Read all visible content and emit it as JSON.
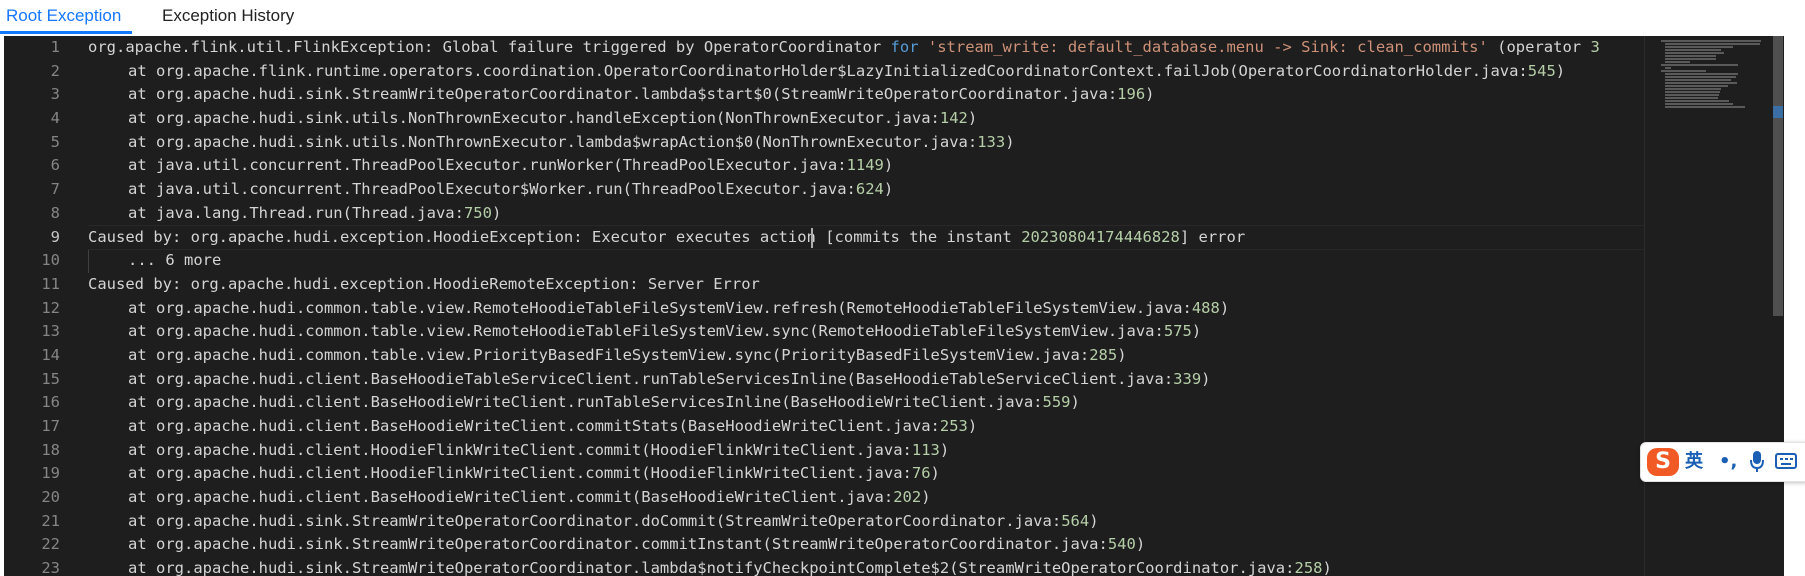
{
  "tabs": [
    {
      "label": "Root Exception",
      "active": true
    },
    {
      "label": "Exception History",
      "active": false
    }
  ],
  "editor": {
    "active_line": 9,
    "lines": [
      {
        "n": "1",
        "indent": 0,
        "segs": [
          [
            "t",
            "org.apache.flink.util.FlinkException: Global failure triggered by OperatorCoordinator "
          ],
          [
            "k",
            "for"
          ],
          [
            "t",
            " "
          ],
          [
            "s",
            "'stream_write: default_database.menu -> Sink: clean_commits'"
          ],
          [
            "t",
            " (operator "
          ],
          [
            "n",
            "3"
          ]
        ]
      },
      {
        "n": "2",
        "indent": 1,
        "segs": [
          [
            "t",
            "at org.apache.flink.runtime.operators.coordination.OperatorCoordinatorHolder$LazyInitializedCoordinatorContext.failJob(OperatorCoordinatorHolder.java:"
          ],
          [
            "n",
            "545"
          ],
          [
            "t",
            ")"
          ]
        ]
      },
      {
        "n": "3",
        "indent": 1,
        "segs": [
          [
            "t",
            "at org.apache.hudi.sink.StreamWriteOperatorCoordinator.lambda$start$0(StreamWriteOperatorCoordinator.java:"
          ],
          [
            "n",
            "196"
          ],
          [
            "t",
            ")"
          ]
        ]
      },
      {
        "n": "4",
        "indent": 1,
        "segs": [
          [
            "t",
            "at org.apache.hudi.sink.utils.NonThrownExecutor.handleException(NonThrownExecutor.java:"
          ],
          [
            "n",
            "142"
          ],
          [
            "t",
            ")"
          ]
        ]
      },
      {
        "n": "5",
        "indent": 1,
        "segs": [
          [
            "t",
            "at org.apache.hudi.sink.utils.NonThrownExecutor.lambda$wrapAction$0(NonThrownExecutor.java:"
          ],
          [
            "n",
            "133"
          ],
          [
            "t",
            ")"
          ]
        ]
      },
      {
        "n": "6",
        "indent": 1,
        "segs": [
          [
            "t",
            "at java.util.concurrent.ThreadPoolExecutor.runWorker(ThreadPoolExecutor.java:"
          ],
          [
            "n",
            "1149"
          ],
          [
            "t",
            ")"
          ]
        ]
      },
      {
        "n": "7",
        "indent": 1,
        "segs": [
          [
            "t",
            "at java.util.concurrent.ThreadPoolExecutor$Worker.run(ThreadPoolExecutor.java:"
          ],
          [
            "n",
            "624"
          ],
          [
            "t",
            ")"
          ]
        ]
      },
      {
        "n": "8",
        "indent": 1,
        "segs": [
          [
            "t",
            "at java.lang.Thread.run(Thread.java:"
          ],
          [
            "n",
            "750"
          ],
          [
            "t",
            ")"
          ]
        ]
      },
      {
        "n": "9",
        "indent": 0,
        "segs": [
          [
            "t",
            "Caused by: org.apache.hudi.exception.HoodieException: Executor executes action [commits the instant "
          ],
          [
            "n",
            "20230804174446828"
          ],
          [
            "t",
            "] error"
          ]
        ]
      },
      {
        "n": "10",
        "indent": 2,
        "segs": [
          [
            "t",
            "... 6 more"
          ]
        ]
      },
      {
        "n": "11",
        "indent": 0,
        "segs": [
          [
            "t",
            "Caused by: org.apache.hudi.exception.HoodieRemoteException: Server Error"
          ]
        ]
      },
      {
        "n": "12",
        "indent": 1,
        "segs": [
          [
            "t",
            "at org.apache.hudi.common.table.view.RemoteHoodieTableFileSystemView.refresh(RemoteHoodieTableFileSystemView.java:"
          ],
          [
            "n",
            "488"
          ],
          [
            "t",
            ")"
          ]
        ]
      },
      {
        "n": "13",
        "indent": 1,
        "segs": [
          [
            "t",
            "at org.apache.hudi.common.table.view.RemoteHoodieTableFileSystemView.sync(RemoteHoodieTableFileSystemView.java:"
          ],
          [
            "n",
            "575"
          ],
          [
            "t",
            ")"
          ]
        ]
      },
      {
        "n": "14",
        "indent": 1,
        "segs": [
          [
            "t",
            "at org.apache.hudi.common.table.view.PriorityBasedFileSystemView.sync(PriorityBasedFileSystemView.java:"
          ],
          [
            "n",
            "285"
          ],
          [
            "t",
            ")"
          ]
        ]
      },
      {
        "n": "15",
        "indent": 1,
        "segs": [
          [
            "t",
            "at org.apache.hudi.client.BaseHoodieTableServiceClient.runTableServicesInline(BaseHoodieTableServiceClient.java:"
          ],
          [
            "n",
            "339"
          ],
          [
            "t",
            ")"
          ]
        ]
      },
      {
        "n": "16",
        "indent": 1,
        "segs": [
          [
            "t",
            "at org.apache.hudi.client.BaseHoodieWriteClient.runTableServicesInline(BaseHoodieWriteClient.java:"
          ],
          [
            "n",
            "559"
          ],
          [
            "t",
            ")"
          ]
        ]
      },
      {
        "n": "17",
        "indent": 1,
        "segs": [
          [
            "t",
            "at org.apache.hudi.client.BaseHoodieWriteClient.commitStats(BaseHoodieWriteClient.java:"
          ],
          [
            "n",
            "253"
          ],
          [
            "t",
            ")"
          ]
        ]
      },
      {
        "n": "18",
        "indent": 1,
        "segs": [
          [
            "t",
            "at org.apache.hudi.client.HoodieFlinkWriteClient.commit(HoodieFlinkWriteClient.java:"
          ],
          [
            "n",
            "113"
          ],
          [
            "t",
            ")"
          ]
        ]
      },
      {
        "n": "19",
        "indent": 1,
        "segs": [
          [
            "t",
            "at org.apache.hudi.client.HoodieFlinkWriteClient.commit(HoodieFlinkWriteClient.java:"
          ],
          [
            "n",
            "76"
          ],
          [
            "t",
            ")"
          ]
        ]
      },
      {
        "n": "20",
        "indent": 1,
        "segs": [
          [
            "t",
            "at org.apache.hudi.client.BaseHoodieWriteClient.commit(BaseHoodieWriteClient.java:"
          ],
          [
            "n",
            "202"
          ],
          [
            "t",
            ")"
          ]
        ]
      },
      {
        "n": "21",
        "indent": 1,
        "segs": [
          [
            "t",
            "at org.apache.hudi.sink.StreamWriteOperatorCoordinator.doCommit(StreamWriteOperatorCoordinator.java:"
          ],
          [
            "n",
            "564"
          ],
          [
            "t",
            ")"
          ]
        ]
      },
      {
        "n": "22",
        "indent": 1,
        "segs": [
          [
            "t",
            "at org.apache.hudi.sink.StreamWriteOperatorCoordinator.commitInstant(StreamWriteOperatorCoordinator.java:"
          ],
          [
            "n",
            "540"
          ],
          [
            "t",
            ")"
          ]
        ]
      },
      {
        "n": "23",
        "indent": 1,
        "segs": [
          [
            "t",
            "at org.apache.hudi.sink.StreamWriteOperatorCoordinator.lambda$notifyCheckpointComplete$2(StreamWriteOperatorCoordinator.java:"
          ],
          [
            "n",
            "258"
          ],
          [
            "t",
            ")"
          ]
        ]
      }
    ]
  },
  "ime_toolbar": {
    "logo": "S",
    "lang": "英",
    "punct": "•,",
    "mic_icon": "microphone-icon",
    "keyboard_icon": "keyboard-icon"
  },
  "colors": {
    "accent": "#1677ff",
    "editor_bg": "#1e1e1e",
    "keyword": "#569cd6",
    "string": "#ce9178",
    "number": "#b5cea8",
    "ime_logo": "#f15a24"
  }
}
